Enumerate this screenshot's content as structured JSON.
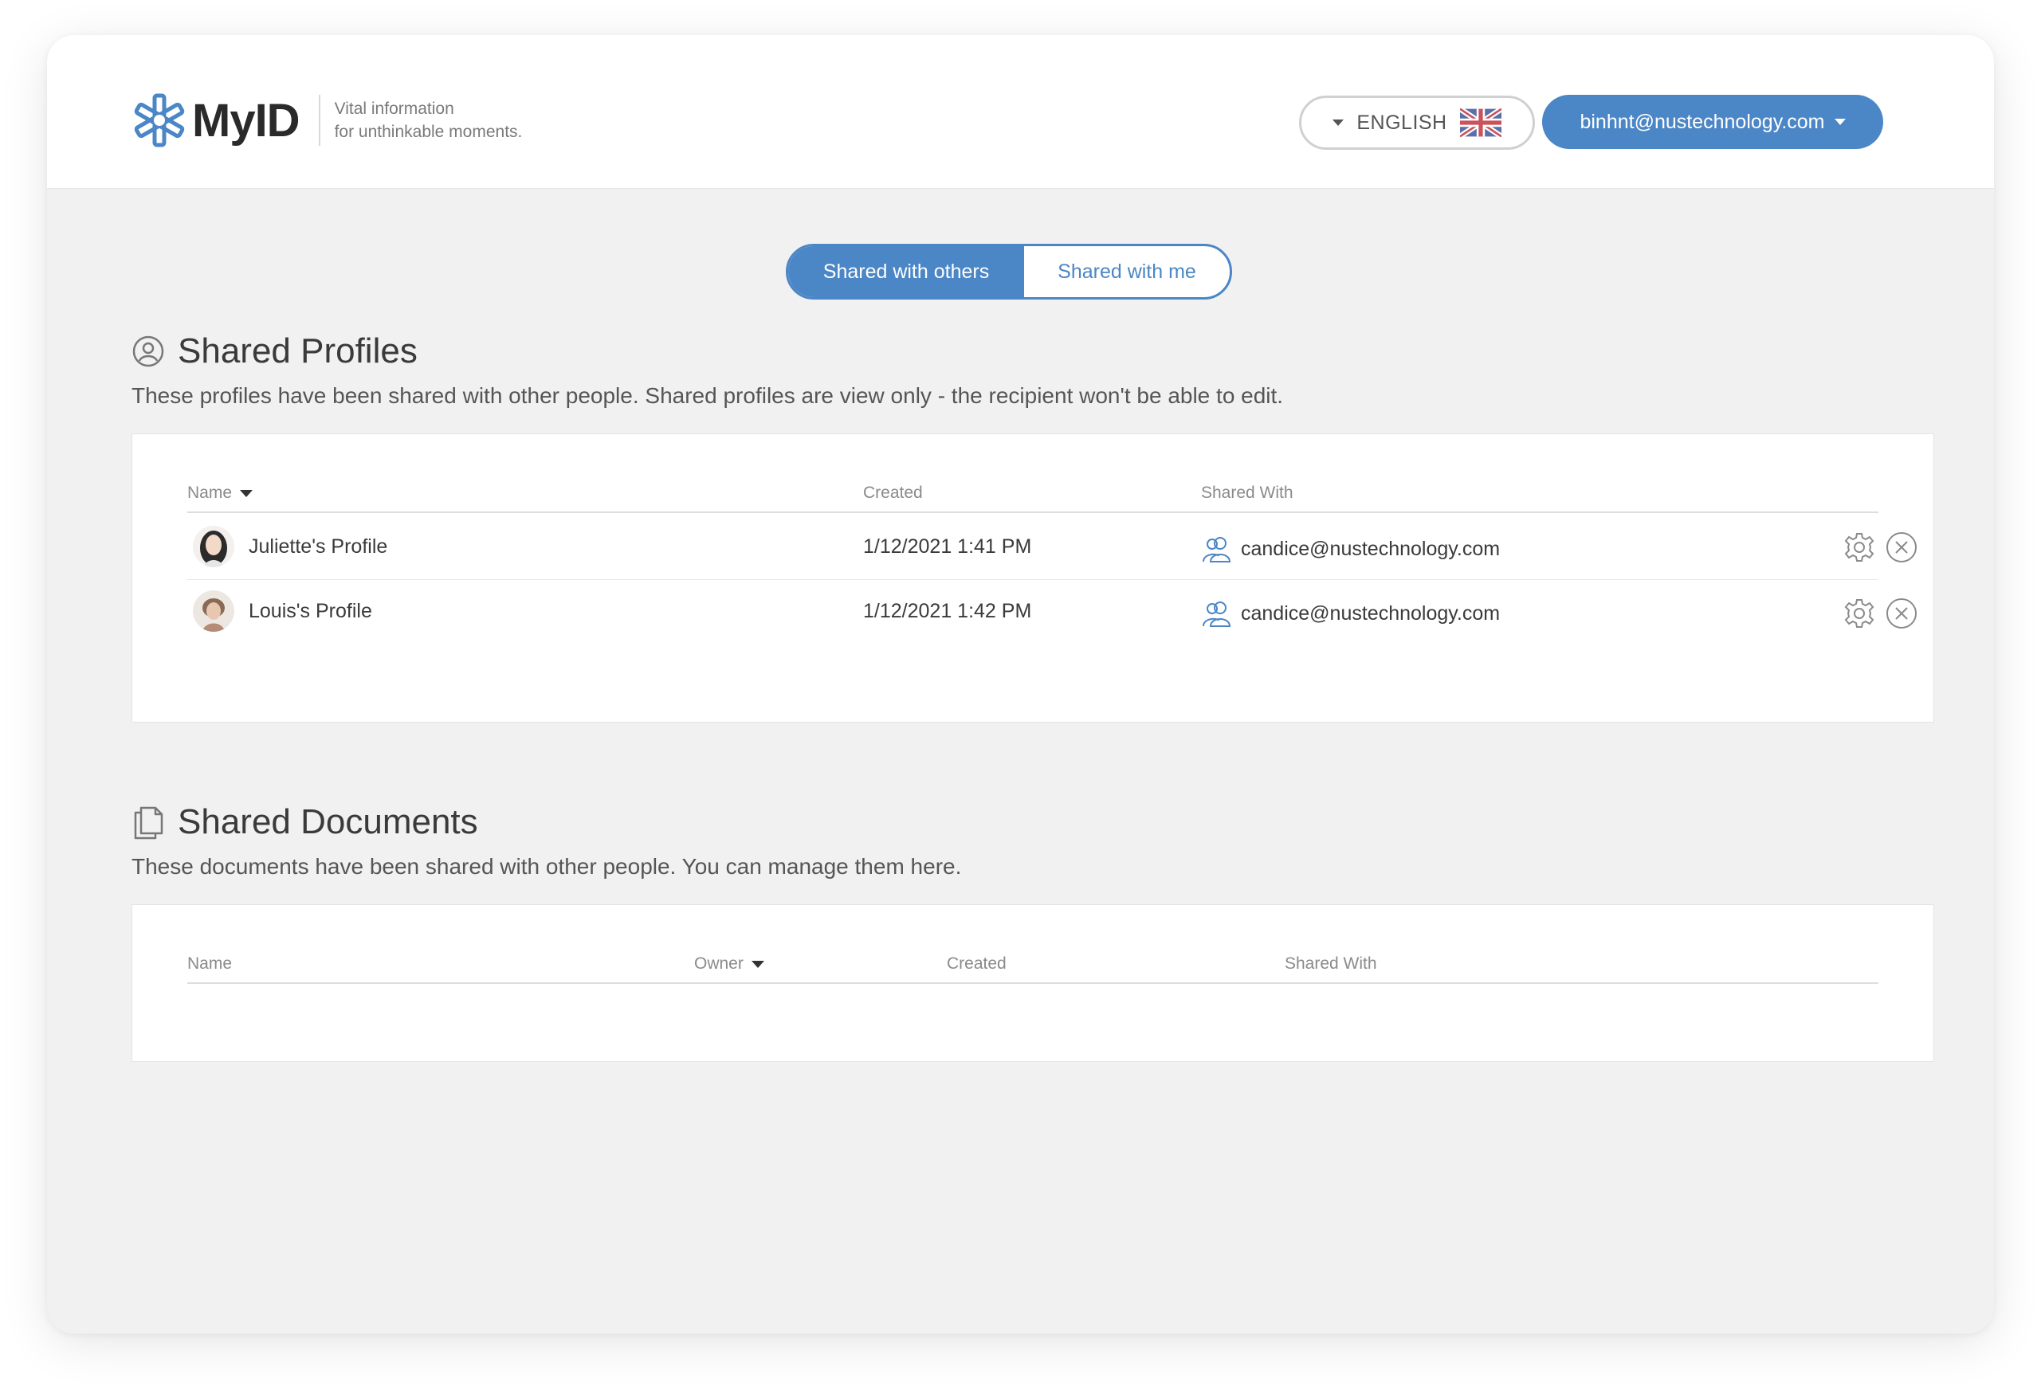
{
  "header": {
    "logo_text": "MyID",
    "tagline_line1": "Vital information",
    "tagline_line2": "for unthinkable moments.",
    "language_label": "ENGLISH",
    "user_email": "binhnt@nustechnology.com"
  },
  "tabs": {
    "active_label": "Shared with others",
    "inactive_label": "Shared with me"
  },
  "profiles": {
    "title": "Shared Profiles",
    "description": "These profiles have been shared with other people. Shared profiles are view only - the recipient won't be able to edit.",
    "columns": {
      "name": "Name",
      "created": "Created",
      "shared_with": "Shared With"
    },
    "rows": [
      {
        "name": "Juliette's Profile",
        "created": "1/12/2021 1:41 PM",
        "shared_with": "candice@nustechnology.com"
      },
      {
        "name": "Louis's Profile",
        "created": "1/12/2021 1:42 PM",
        "shared_with": "candice@nustechnology.com"
      }
    ]
  },
  "documents": {
    "title": "Shared Documents",
    "description": "These documents have been shared with other people. You can manage them here.",
    "columns": {
      "name": "Name",
      "owner": "Owner",
      "created": "Created",
      "shared_with": "Shared With"
    }
  },
  "colors": {
    "accent": "#4b86c6",
    "background": "#f1f1f1"
  }
}
